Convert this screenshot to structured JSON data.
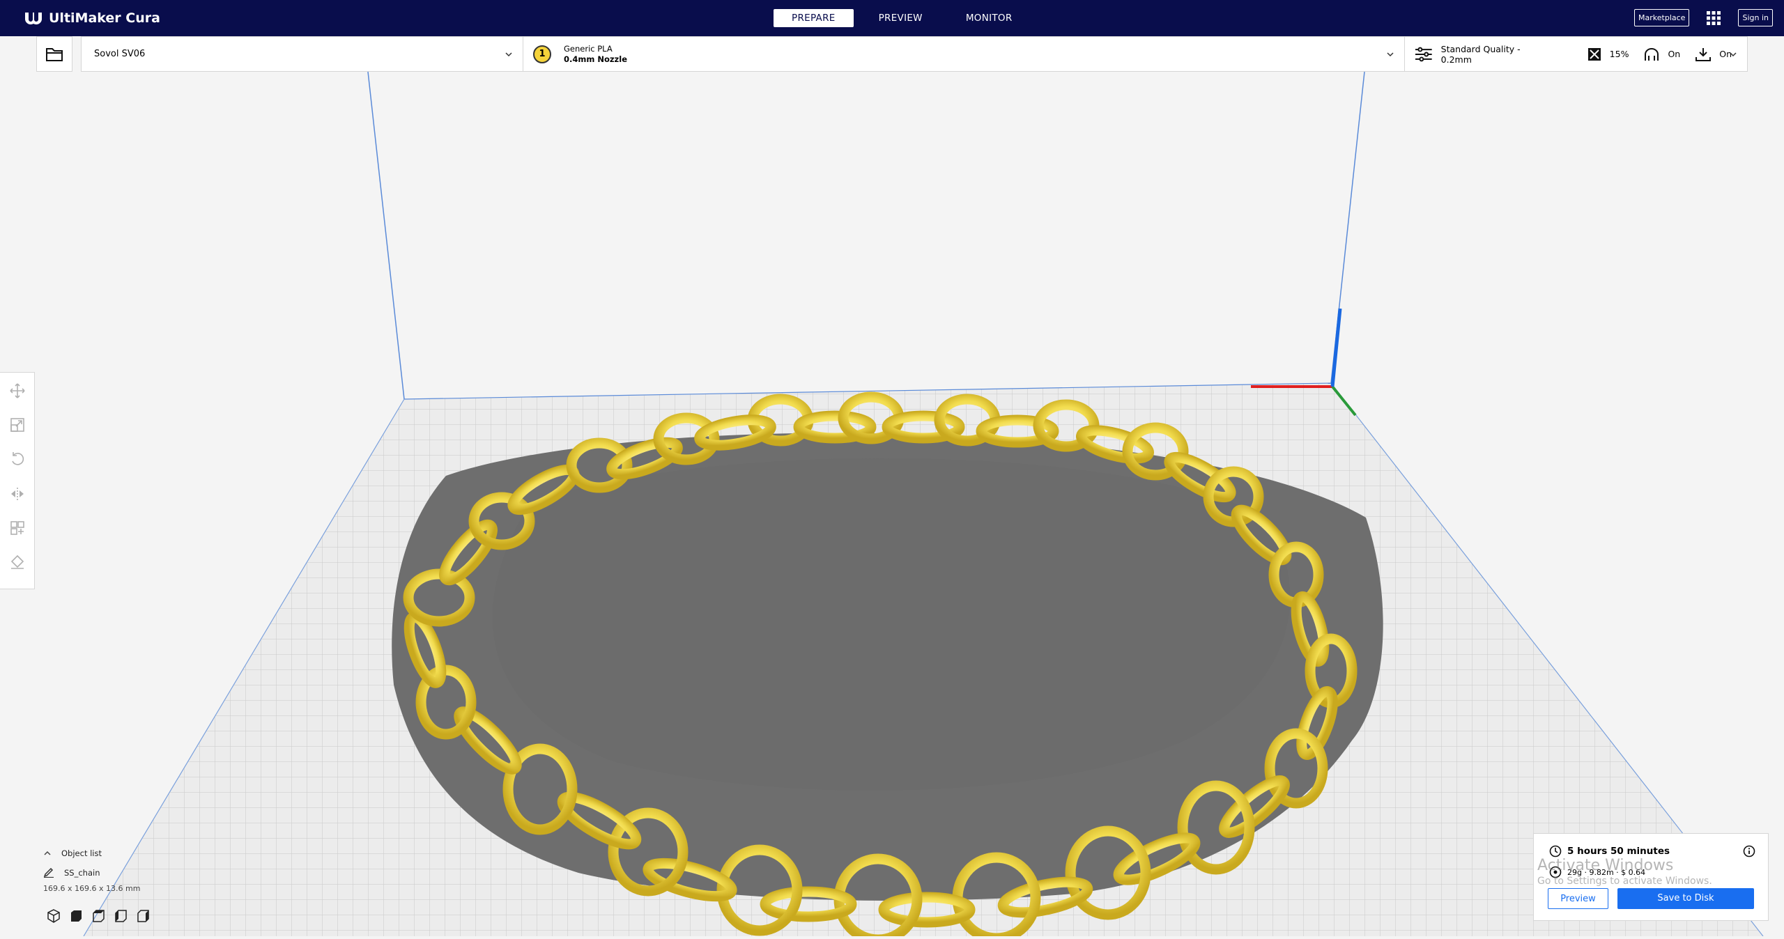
{
  "app": {
    "name": "UltiMaker Cura"
  },
  "header": {
    "tabs": [
      {
        "label": "PREPARE",
        "active": true
      },
      {
        "label": "PREVIEW",
        "active": false
      },
      {
        "label": "MONITOR",
        "active": false
      }
    ],
    "marketplace_label": "Marketplace",
    "signin_label": "Sign in"
  },
  "stage": {
    "printer": "Sovol SV06",
    "material_badge": "1",
    "material_name": "Generic PLA",
    "nozzle": "0.4mm Nozzle",
    "profile": "Standard Quality - 0.2mm",
    "infill": "15%",
    "support": "On",
    "adhesion": "On"
  },
  "object_list": {
    "header": "Object list",
    "item": "SS_chain",
    "dimensions": "169.6 x 169.6 x 13.6 mm"
  },
  "action_panel": {
    "time": "5 hours 50 minutes",
    "material_usage": "29g · 9.82m · $ 0.64",
    "preview_label": "Preview",
    "save_label": "Save to Disk"
  },
  "watermark": {
    "line1": "Activate Windows",
    "line2": "Go to Settings to activate Windows."
  },
  "colors": {
    "header_bg": "#090d4c",
    "accent": "#196ef0",
    "model": "#f2dc4e",
    "axis_x": "#e02020",
    "axis_y": "#2a9a3a",
    "axis_z": "#1a68e0"
  }
}
